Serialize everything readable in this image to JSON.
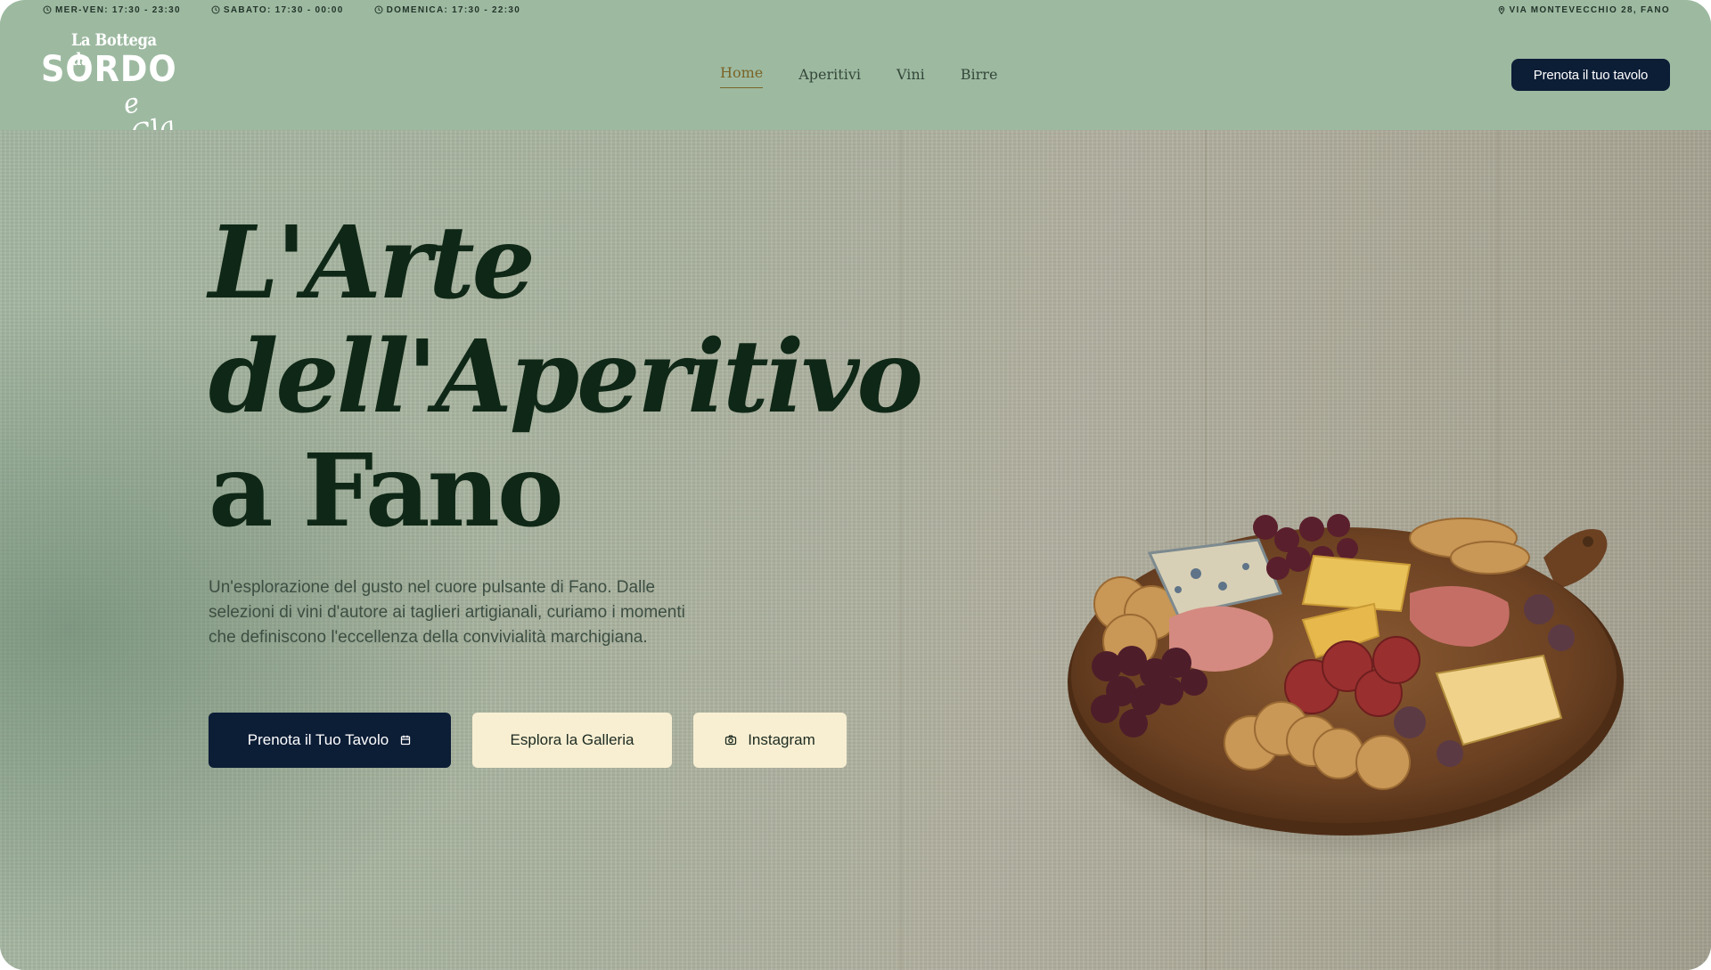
{
  "topbar": {
    "hours": [
      {
        "icon": "clock-icon",
        "text": "MER-VEN: 17:30 - 23:30"
      },
      {
        "icon": "clock-icon",
        "text": "SABATO: 17:30 - 00:00"
      },
      {
        "icon": "clock-icon",
        "text": "DOMENICA: 17:30 - 22:30"
      }
    ],
    "address": {
      "icon": "location-pin-icon",
      "text": "VIA MONTEVECCHIO 28, FANO"
    }
  },
  "header": {
    "logo": {
      "line1": "La Bottega da",
      "line2": "SORDO",
      "line3": "e Cla"
    },
    "nav": [
      "Home",
      "Aperitivi",
      "Vini",
      "Birre"
    ],
    "active_nav": "Home",
    "cta": "Prenota il tuo tavolo"
  },
  "hero": {
    "headline": [
      "L'Arte",
      "dell'Aperitivo",
      "a Fano"
    ],
    "lead": "Un'esplorazione del gusto nel cuore pulsante di Fano. Dalle selezioni di vini d'autore ai taglieri artigianali, curiamo i momenti che definiscono l'eccellenza della convivialità marchigiana.",
    "buttons": {
      "primary": {
        "label": "Prenota il Tuo Tavolo",
        "icon": "calendar-icon"
      },
      "gallery": {
        "label": "Esplora la Galleria"
      },
      "instagram": {
        "label": "Instagram",
        "icon": "camera-icon"
      }
    },
    "image": {
      "subject": "charcuterie-board-illustration"
    }
  },
  "colors": {
    "header_bg": "#9dbaa1",
    "navy": "#0c1d36",
    "cream": "#f8efd2",
    "headline": "#0f2716",
    "accent_gold": "#7a6426"
  }
}
